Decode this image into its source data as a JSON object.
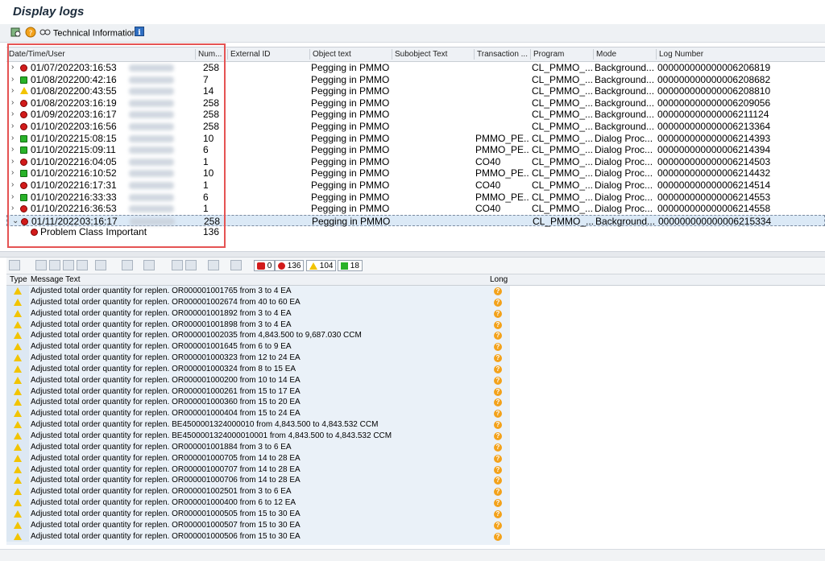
{
  "title": "Display logs",
  "appbar": {
    "tech_info_label": "Technical Information"
  },
  "log_table": {
    "columns": [
      "Date/Time/User",
      "Num...",
      "External ID",
      "Object text",
      "Subobject Text",
      "Transaction ...",
      "Program",
      "Mode",
      "Log Number"
    ],
    "rows": [
      {
        "status": "red",
        "date": "01/07/2022",
        "time": "03:16:53",
        "num": "258",
        "object": "Pegging in PMMO",
        "transaction": "",
        "program": "CL_PMMO_...",
        "mode": "Background...",
        "log": "000000000000006206819"
      },
      {
        "status": "green",
        "date": "01/08/2022",
        "time": "00:42:16",
        "num": "7",
        "object": "Pegging in PMMO",
        "transaction": "",
        "program": "CL_PMMO_...",
        "mode": "Background...",
        "log": "000000000000006208682"
      },
      {
        "status": "yellow",
        "date": "01/08/2022",
        "time": "00:43:55",
        "num": "14",
        "object": "Pegging in PMMO",
        "transaction": "",
        "program": "CL_PMMO_...",
        "mode": "Background...",
        "log": "000000000000006208810"
      },
      {
        "status": "red",
        "date": "01/08/2022",
        "time": "03:16:19",
        "num": "258",
        "object": "Pegging in PMMO",
        "transaction": "",
        "program": "CL_PMMO_...",
        "mode": "Background...",
        "log": "000000000000006209056"
      },
      {
        "status": "red",
        "date": "01/09/2022",
        "time": "03:16:17",
        "num": "258",
        "object": "Pegging in PMMO",
        "transaction": "",
        "program": "CL_PMMO_...",
        "mode": "Background...",
        "log": "000000000000006211124"
      },
      {
        "status": "red",
        "date": "01/10/2022",
        "time": "03:16:56",
        "num": "258",
        "object": "Pegging in PMMO",
        "transaction": "",
        "program": "CL_PMMO_...",
        "mode": "Background...",
        "log": "000000000000006213364"
      },
      {
        "status": "green",
        "date": "01/10/2022",
        "time": "15:08:15",
        "num": "10",
        "object": "Pegging in PMMO",
        "transaction": "PMMO_PE...",
        "program": "CL_PMMO_...",
        "mode": "Dialog Proc...",
        "log": "000000000000006214393"
      },
      {
        "status": "green",
        "date": "01/10/2022",
        "time": "15:09:11",
        "num": "6",
        "object": "Pegging in PMMO",
        "transaction": "PMMO_PE...",
        "program": "CL_PMMO_...",
        "mode": "Dialog Proc...",
        "log": "000000000000006214394"
      },
      {
        "status": "red",
        "date": "01/10/2022",
        "time": "16:04:05",
        "num": "1",
        "object": "Pegging in PMMO",
        "transaction": "CO40",
        "program": "CL_PMMO_...",
        "mode": "Dialog Proc...",
        "log": "000000000000006214503"
      },
      {
        "status": "green",
        "date": "01/10/2022",
        "time": "16:10:52",
        "num": "10",
        "object": "Pegging in PMMO",
        "transaction": "PMMO_PE...",
        "program": "CL_PMMO_...",
        "mode": "Dialog Proc...",
        "log": "000000000000006214432"
      },
      {
        "status": "red",
        "date": "01/10/2022",
        "time": "16:17:31",
        "num": "1",
        "object": "Pegging in PMMO",
        "transaction": "CO40",
        "program": "CL_PMMO_...",
        "mode": "Dialog Proc...",
        "log": "000000000000006214514"
      },
      {
        "status": "green",
        "date": "01/10/2022",
        "time": "16:33:33",
        "num": "6",
        "object": "Pegging in PMMO",
        "transaction": "PMMO_PE...",
        "program": "CL_PMMO_...",
        "mode": "Dialog Proc...",
        "log": "000000000000006214553"
      },
      {
        "status": "red",
        "date": "01/10/2022",
        "time": "16:36:53",
        "num": "1",
        "object": "Pegging in PMMO",
        "transaction": "CO40",
        "program": "CL_PMMO_...",
        "mode": "Dialog Proc...",
        "log": "000000000000006214558"
      },
      {
        "status": "red",
        "date": "01/11/2022",
        "time": "03:16:17",
        "num": "258",
        "object": "Pegging in PMMO",
        "transaction": "",
        "program": "CL_PMMO_...",
        "mode": "Background...",
        "log": "000000000000006215334",
        "selected": true,
        "expanded": true
      }
    ],
    "sub_rows": [
      {
        "label": "Problem Class Important",
        "num": "136"
      }
    ]
  },
  "counters": {
    "stop": "0",
    "red": "136",
    "yellow": "104",
    "green": "18"
  },
  "messages": {
    "columns": [
      "Type",
      "Message Text",
      "Long"
    ],
    "rows": [
      "Adjusted total order quantity for replen. OR000001001765 from 3 to 4 EA",
      "Adjusted total order quantity for replen. OR000001002674 from 40 to 60 EA",
      "Adjusted total order quantity for replen. OR000001001892 from 3 to 4 EA",
      "Adjusted total order quantity for replen. OR000001001898 from 3 to 4 EA",
      "Adjusted total order quantity for replen. OR000001002035 from 4,843.500 to 9,687.030 CCM",
      "Adjusted total order quantity for replen. OR000001001645 from 6 to 9 EA",
      "Adjusted total order quantity for replen. OR000001000323 from 12 to 24 EA",
      "Adjusted total order quantity for replen. OR000001000324 from 8 to 15 EA",
      "Adjusted total order quantity for replen. OR000001000200 from 10 to 14 EA",
      "Adjusted total order quantity for replen. OR000001000261 from 15 to 17 EA",
      "Adjusted total order quantity for replen. OR000001000360 from 15 to 20 EA",
      "Adjusted total order quantity for replen. OR000001000404 from 15 to 24 EA",
      "Adjusted total order quantity for replen. BE4500001324000010 from 4,843.500 to 4,843.532 CCM",
      "Adjusted total order quantity for replen. BE4500001324000010001 from 4,843.500 to 4,843.532 CCM",
      "Adjusted total order quantity for replen. OR000001001884 from 3 to 6 EA",
      "Adjusted total order quantity for replen. OR000001000705 from 14 to 28 EA",
      "Adjusted total order quantity for replen. OR000001000707 from 14 to 28 EA",
      "Adjusted total order quantity for replen. OR000001000706 from 14 to 28 EA",
      "Adjusted total order quantity for replen. OR000001002501 from 3 to 6 EA",
      "Adjusted total order quantity for replen. OR000001000400 from 6 to 12 EA",
      "Adjusted total order quantity for replen. OR000001000505 from 15 to 30 EA",
      "Adjusted total order quantity for replen. OR000001000507 from 15 to 30 EA",
      "Adjusted total order quantity for replen. OR000001000506 from 15 to 30 EA"
    ]
  },
  "colors": {
    "error": "#d21b1b",
    "warning": "#f2c400",
    "success": "#29b229",
    "highlight": "#e55353"
  },
  "icons": [
    "find-icon",
    "help-icon",
    "glasses-icon",
    "info-icon"
  ]
}
